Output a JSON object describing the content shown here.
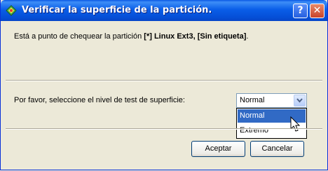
{
  "window": {
    "title": "Verificar la superficie de la partición.",
    "help_label": "?",
    "close_label": "✕"
  },
  "message": {
    "prefix": "Está a punto de chequear la partición ",
    "bold": "[*] Linux Ext3, [Sin etiqueta]",
    "suffix": "."
  },
  "surface_test": {
    "prompt": "Por favor, seleccione el nivel de test de superficie:",
    "selected": "Normal",
    "options": [
      "Normal",
      "Extremo"
    ]
  },
  "buttons": {
    "accept": "Aceptar",
    "cancel": "Cancelar"
  },
  "colors": {
    "titlebar": "#0a5ee8",
    "selection": "#316ac5",
    "close": "#c8432a"
  },
  "icons": {
    "app": "partition-wizard-icon",
    "help": "help-icon",
    "close": "close-icon",
    "dropdown": "chevron-down-icon",
    "cursor": "mouse-pointer-icon"
  }
}
